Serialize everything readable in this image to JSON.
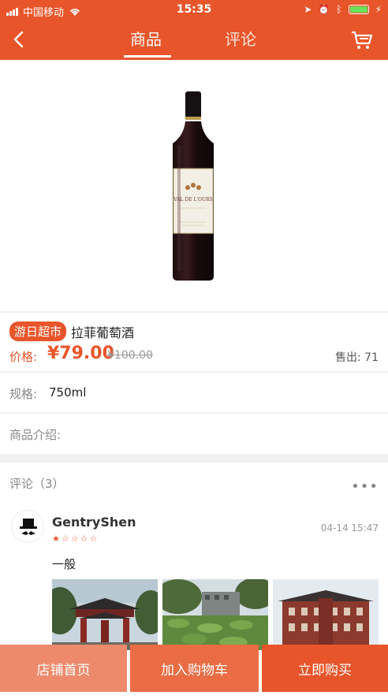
{
  "status": {
    "carrier": "中国移动",
    "time": "15:35"
  },
  "nav": {
    "tab_goods": "商品",
    "tab_review": "评论"
  },
  "product": {
    "shop_tag": "游日超市",
    "name": "拉菲葡萄酒",
    "price_label": "价格:",
    "price": "¥79.00",
    "old_price": "¥100.00",
    "sold": "售出:  71",
    "spec_label": "规格:",
    "spec_value": "750ml",
    "intro_label": "商品介绍:",
    "label_text": "VAL DE L'OURS"
  },
  "reviews": {
    "title": "评论（3）",
    "items": [
      {
        "user": "GentryShen",
        "date": "04-14 15:47",
        "rating": 1,
        "text": "一般"
      }
    ]
  },
  "bottom_bar": {
    "shop_home": "店铺首页",
    "add_cart": "加入购物车",
    "buy_now": "立即购买"
  },
  "colors": {
    "accent": "#e8552a",
    "accent_light": "#ec8a6b",
    "accent_mid": "#e96c44"
  }
}
